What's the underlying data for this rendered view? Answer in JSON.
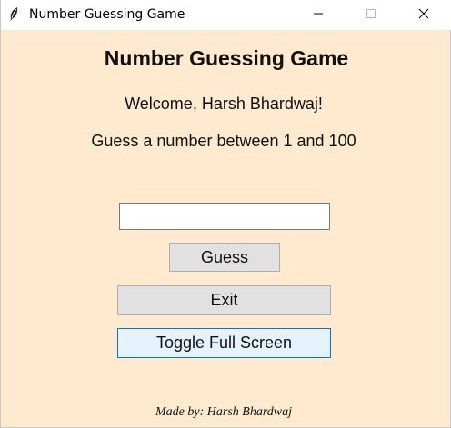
{
  "window": {
    "title": "Number Guessing Game",
    "icon": "feather-icon",
    "background": "#ffe9cf"
  },
  "main": {
    "heading": "Number Guessing Game",
    "welcome": "Welcome, Harsh Bhardwaj!",
    "instructions": "Guess a number between 1 and 100",
    "guess_input_value": "",
    "guess_label": "Guess",
    "exit_label": "Exit",
    "toggle_label": "Toggle Full Screen"
  },
  "footer": {
    "credit": "Made by: Harsh Bhardwaj"
  },
  "colors": {
    "button_bg": "#e1e1e1",
    "focused_button_bg": "#e5f1fb",
    "focused_button_border": "#0078d7"
  }
}
